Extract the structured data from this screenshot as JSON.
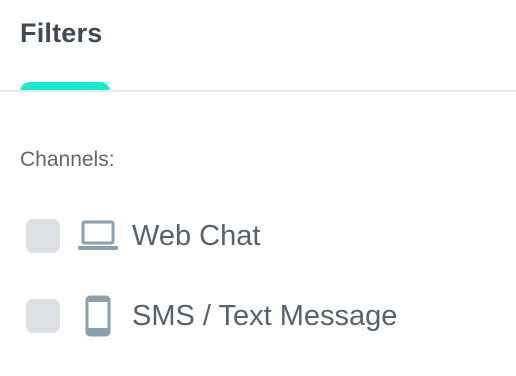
{
  "header": {
    "title": "Filters"
  },
  "filters": {
    "section_label": "Channels:",
    "options": [
      {
        "label": "Web Chat",
        "icon": "laptop-icon",
        "checked": false
      },
      {
        "label": "SMS / Text Message",
        "icon": "mobile-phone-icon",
        "checked": false
      }
    ]
  },
  "colors": {
    "accent": "#14ecce",
    "icon": "#8aa0ad",
    "checkbox": "#dde1e6",
    "divider": "#e7eaec"
  }
}
